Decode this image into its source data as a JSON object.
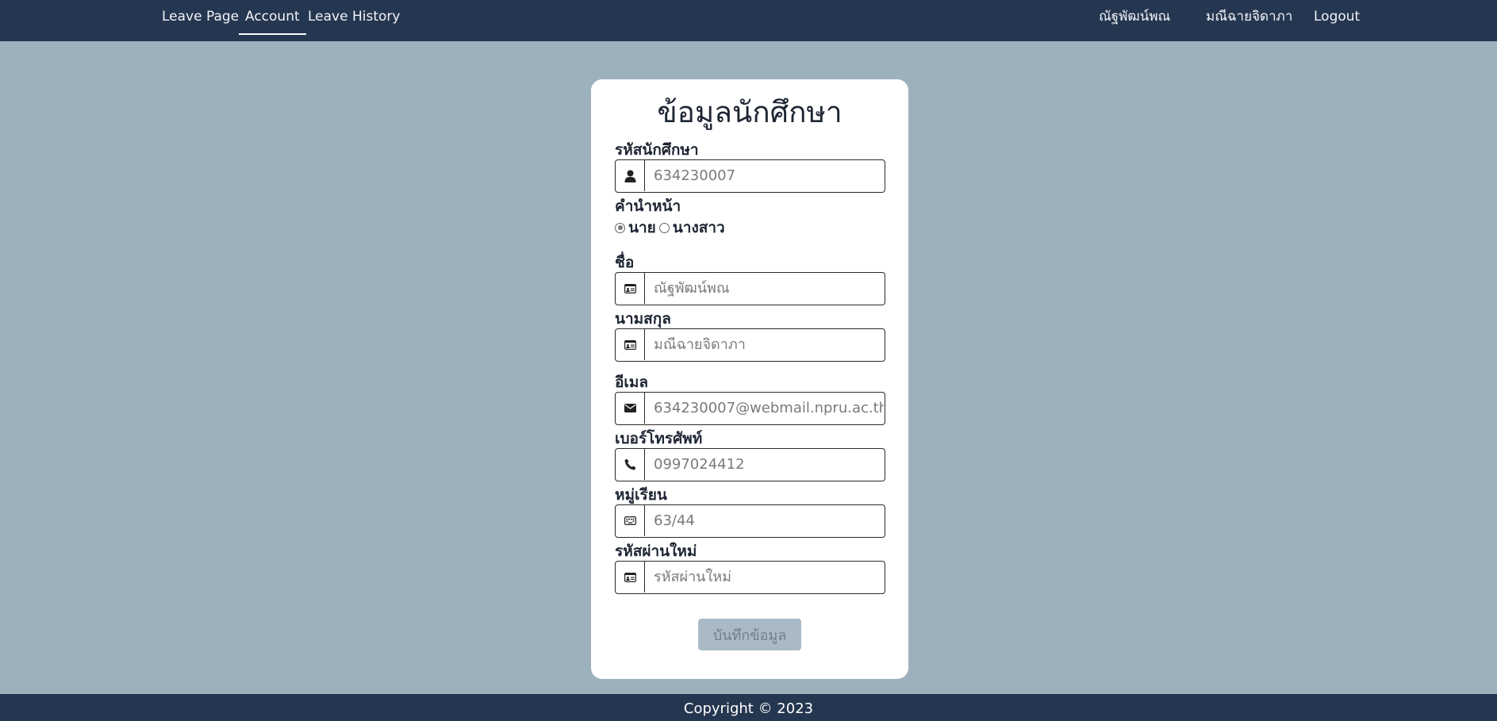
{
  "nav": {
    "left": [
      {
        "label": "Leave Page"
      },
      {
        "label": "Account",
        "active": true
      },
      {
        "label": "Leave History"
      }
    ],
    "right": [
      {
        "label": "ณัฐพัฒน์พณ"
      },
      {
        "label": "มณีฉายจิดาภา"
      },
      {
        "label": "Logout"
      }
    ]
  },
  "card": {
    "title": "ข้อมูลนักศึกษา",
    "student_id": {
      "label": "รหัสนักศึกษา",
      "placeholder": "634230007",
      "icon": "user-icon"
    },
    "prefix": {
      "label": "คำนำหน้า",
      "options": [
        {
          "label": "นาย",
          "checked": true
        },
        {
          "label": "นางสาว",
          "checked": false
        }
      ]
    },
    "first_name": {
      "label": "ชื่อ",
      "placeholder": "ณัฐพัฒน์พณ",
      "icon": "id-card-icon"
    },
    "last_name": {
      "label": "นามสกุล",
      "placeholder": "มณีฉายจิดาภา",
      "icon": "id-card-icon"
    },
    "email": {
      "label": "อีเมล",
      "placeholder": "634230007@webmail.npru.ac.th",
      "icon": "envelope-icon"
    },
    "phone": {
      "label": "เบอร์โทรศัพท์",
      "placeholder": "0997024412",
      "icon": "phone-icon"
    },
    "group": {
      "label": "หมู่เรียน",
      "placeholder": "63/44",
      "icon": "keyboard-icon"
    },
    "new_password": {
      "label": "รหัสผ่านใหม่",
      "placeholder": "รหัสผ่านใหม่",
      "icon": "id-card-icon"
    },
    "save_label": "บันทึกข้อมูล"
  },
  "footer": {
    "text": "Copyright © 2023"
  },
  "colors": {
    "nav_bg": "#253650",
    "page_bg": "#9db1bd",
    "card_bg": "#ffffff",
    "button_bg": "#a9bac6"
  }
}
